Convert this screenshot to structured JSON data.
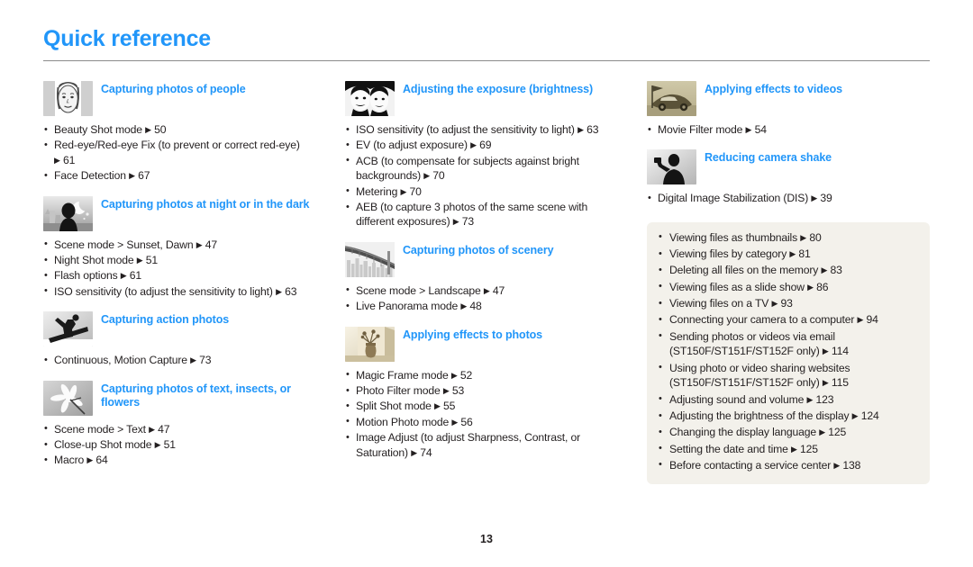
{
  "header": {
    "title": "Quick reference"
  },
  "footer": {
    "page_number": "13"
  },
  "colors": {
    "heading_blue": "#2196f9",
    "body_text": "#231f20",
    "info_box_bg": "#f3f1eb",
    "rule": "#8b8b8b"
  },
  "columns": [
    {
      "sections": [
        {
          "title": "Capturing photos of people",
          "thumb": "portrait-face-thumbnail",
          "items": [
            {
              "text": "Beauty Shot mode",
              "page": "50"
            },
            {
              "text": "Red-eye/Red-eye Fix (to prevent or correct red-eye)",
              "page": "61",
              "wrap": true
            },
            {
              "text": "Face Detection",
              "page": "67"
            }
          ]
        },
        {
          "title": "Capturing photos at night or in the dark",
          "thumb": "night-silhouette-moon-thumbnail",
          "items": [
            {
              "text": "Scene mode > Sunset, Dawn",
              "page": "47"
            },
            {
              "text": "Night Shot mode",
              "page": "51"
            },
            {
              "text": "Flash options",
              "page": "61"
            },
            {
              "text": "ISO sensitivity (to adjust the sensitivity to light)",
              "page": "63"
            }
          ]
        },
        {
          "title": "Capturing action photos",
          "thumb": "snowboarder-action-thumbnail",
          "items": [
            {
              "text": "Continuous, Motion Capture",
              "page": "73"
            }
          ]
        },
        {
          "title": "Capturing photos of text, insects, or flowers",
          "thumb": "flower-macro-thumbnail",
          "items": [
            {
              "text": "Scene mode > Text",
              "page": "47"
            },
            {
              "text": "Close-up Shot mode",
              "page": "51"
            },
            {
              "text": "Macro",
              "page": "64"
            }
          ]
        }
      ]
    },
    {
      "sections": [
        {
          "title": "Adjusting the exposure (brightness)",
          "thumb": "two-faces-contrast-thumbnail",
          "items": [
            {
              "text": "ISO sensitivity (to adjust the sensitivity to light)",
              "page": "63"
            },
            {
              "text": "EV (to adjust exposure)",
              "page": "69"
            },
            {
              "text": "ACB (to compensate for subjects against bright",
              "cont": "backgrounds)",
              "page": "70",
              "wrap": true
            },
            {
              "text": "Metering",
              "page": "70"
            },
            {
              "text": "AEB (to capture 3 photos of the same scene with",
              "cont": "different exposures)",
              "page": "73",
              "wrap": true
            }
          ]
        },
        {
          "title": "Capturing photos of scenery",
          "thumb": "bridge-skyline-thumbnail",
          "items": [
            {
              "text": "Scene mode > Landscape",
              "page": "47"
            },
            {
              "text": "Live Panorama mode",
              "page": "48"
            }
          ]
        },
        {
          "title": "Applying effects to photos",
          "thumb": "sepia-vase-thumbnail",
          "items": [
            {
              "text": "Magic Frame mode",
              "page": "52"
            },
            {
              "text": "Photo Filter mode",
              "page": "53"
            },
            {
              "text": "Split Shot mode",
              "page": "55"
            },
            {
              "text": "Motion Photo mode",
              "page": "56"
            },
            {
              "text": "Image Adjust (to adjust Sharpness, Contrast, or",
              "cont": "Saturation)",
              "page": "74",
              "wrap": true
            }
          ]
        }
      ]
    },
    {
      "sections": [
        {
          "title": "Applying effects to videos",
          "thumb": "sepia-car-flag-thumbnail",
          "items": [
            {
              "text": "Movie Filter mode",
              "page": "54"
            }
          ]
        },
        {
          "title": "Reducing camera shake",
          "thumb": "person-holding-camera-thumbnail",
          "items": [
            {
              "text": "Digital Image Stabilization (DIS)",
              "page": "39"
            }
          ]
        }
      ],
      "info_box": {
        "items": [
          {
            "text": "Viewing files as thumbnails",
            "page": "80"
          },
          {
            "text": "Viewing files by category",
            "page": "81"
          },
          {
            "text": "Deleting all files on the memory",
            "page": "83"
          },
          {
            "text": "Viewing files as a slide show",
            "page": "86"
          },
          {
            "text": "Viewing files on a TV",
            "page": "93"
          },
          {
            "text": "Connecting your camera to a computer",
            "page": "94"
          },
          {
            "text": "Sending photos or videos via email",
            "cont": "(ST150F/ST151F/ST152F only)",
            "page": "114",
            "wrap": true
          },
          {
            "text": "Using photo or video sharing websites",
            "cont": "(ST150F/ST151F/ST152F only)",
            "page": "115",
            "wrap": true
          },
          {
            "text": "Adjusting sound and volume",
            "page": "123"
          },
          {
            "text": "Adjusting the brightness of the display",
            "page": "124"
          },
          {
            "text": "Changing the display language",
            "page": "125"
          },
          {
            "text": "Setting the date and time",
            "page": "125"
          },
          {
            "text": "Before contacting a service center",
            "page": "138"
          }
        ]
      }
    }
  ]
}
